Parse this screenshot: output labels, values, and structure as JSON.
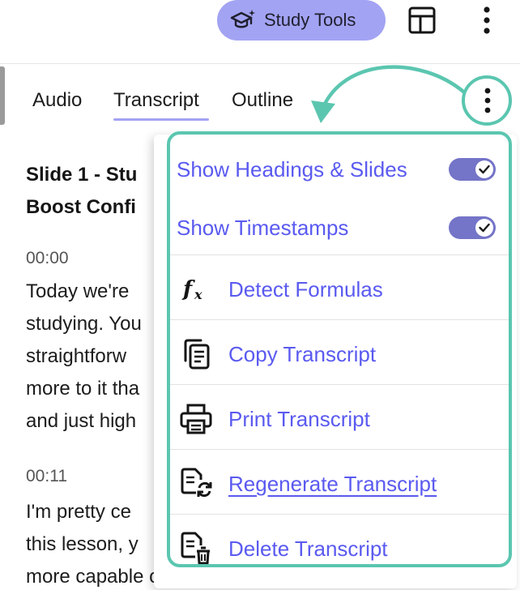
{
  "header": {
    "study_tools_label": "Study Tools",
    "study_tools_icon": "graduation-cap-sparkle-icon",
    "layout_icon": "layout-panel-icon",
    "more_icon": "vertical-dots-icon"
  },
  "tabs": [
    {
      "label": "Audio"
    },
    {
      "label": "Transcript"
    },
    {
      "label": "Outline"
    }
  ],
  "transcript": {
    "heading_line1": "Slide 1 - Stu",
    "heading_line2": "Boost Confi",
    "blocks": [
      {
        "time": "00:00",
        "lines": [
          "Today we're",
          "studying. You",
          "straightforw",
          "more to it tha",
          "and just high"
        ]
      },
      {
        "time": "00:11",
        "lines": [
          "I'm pretty ce",
          "this lesson, y",
          "more capable of achieving those higher"
        ]
      }
    ]
  },
  "menu": {
    "items": [
      {
        "label": "Show Headings & Slides",
        "type": "toggle",
        "on": true
      },
      {
        "label": "Show Timestamps",
        "type": "toggle",
        "on": true
      },
      {
        "label": "Detect Formulas",
        "icon": "formula-fx-icon"
      },
      {
        "label": "Copy Transcript",
        "icon": "copy-document-icon"
      },
      {
        "label": "Print Transcript",
        "icon": "printer-icon"
      },
      {
        "label": "Regenerate Transcript",
        "icon": "regenerate-document-icon"
      },
      {
        "label": "Delete Transcript",
        "icon": "delete-document-icon"
      }
    ]
  },
  "colors": {
    "accent": "#a3a3f3",
    "menu_text": "#5a5af0",
    "annotation": "#5bc6b0",
    "toggle_on": "#7474c8"
  }
}
